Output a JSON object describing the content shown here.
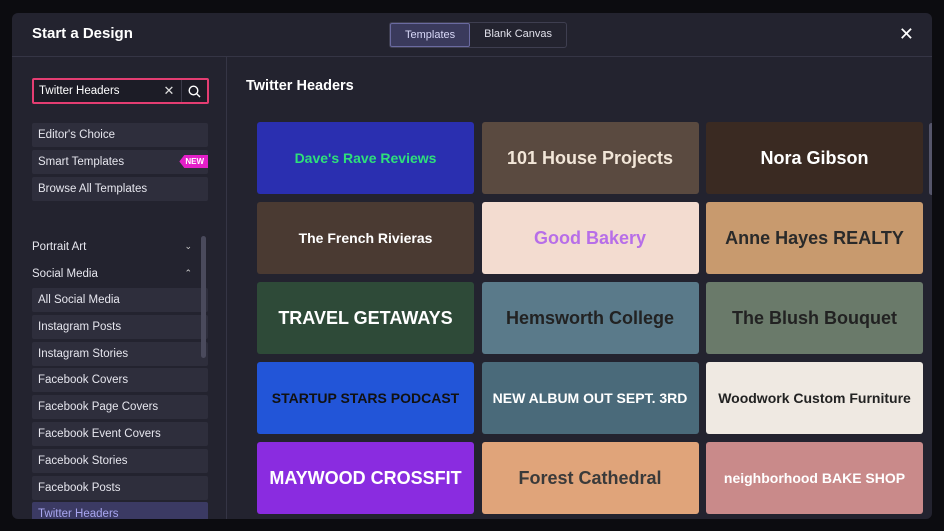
{
  "header": {
    "title": "Start a Design",
    "tabs": [
      "Templates",
      "Blank Canvas"
    ],
    "active_tab": "Templates",
    "close_icon": "close-icon"
  },
  "search": {
    "value": "Twitter Headers"
  },
  "quick": [
    {
      "label": "Editor's Choice"
    },
    {
      "label": "Smart Templates",
      "badge": "NEW"
    },
    {
      "label": "Browse All Templates"
    }
  ],
  "categories": [
    {
      "label": "Portrait Art",
      "expanded": false
    },
    {
      "label": "Social Media",
      "expanded": true
    }
  ],
  "social_items": [
    "All Social Media",
    "Instagram Posts",
    "Instagram Stories",
    "Facebook Covers",
    "Facebook Page Covers",
    "Facebook Event Covers",
    "Facebook Stories",
    "Facebook Posts",
    "Twitter Headers"
  ],
  "selected": "Twitter Headers",
  "main": {
    "title": "Twitter Headers"
  },
  "templates": [
    {
      "text": "Dave's Rave Reviews",
      "bg": "#2a2fb0",
      "fg": "#2ee07a"
    },
    {
      "text": "101 House Projects",
      "bg": "#5a4a40",
      "fg": "#f2e6d8"
    },
    {
      "text": "Nora Gibson",
      "bg": "#3a2a22",
      "fg": "#ffffff"
    },
    {
      "text": "The French Rivieras",
      "bg": "#4a3a32",
      "fg": "#ffffff"
    },
    {
      "text": "Good Bakery",
      "bg": "#f3dcd0",
      "fg": "#b76ee8"
    },
    {
      "text": "Anne Hayes REALTY",
      "bg": "#c89a6e",
      "fg": "#2a2a2a"
    },
    {
      "text": "TRAVEL GETAWAYS",
      "bg": "#2e4a38",
      "fg": "#ffffff"
    },
    {
      "text": "Hemsworth College",
      "bg": "#5a7a8a",
      "fg": "#222222"
    },
    {
      "text": "The Blush Bouquet",
      "bg": "#6a7a6a",
      "fg": "#222222"
    },
    {
      "text": "STARTUP STARS PODCAST",
      "bg": "#2255d8",
      "fg": "#111111"
    },
    {
      "text": "NEW ALBUM OUT SEPT. 3RD",
      "bg": "#4a6a7a",
      "fg": "#ffffff"
    },
    {
      "text": "Woodwork Custom Furniture",
      "bg": "#efe9e2",
      "fg": "#222222"
    },
    {
      "text": "MAYWOOD CROSSFIT",
      "bg": "#8a2ce0",
      "fg": "#ffffff"
    },
    {
      "text": "Forest Cathedral",
      "bg": "#e0a47a",
      "fg": "#3a3a3a"
    },
    {
      "text": "neighborhood BAKE SHOP",
      "bg": "#c98a8a",
      "fg": "#ffffff"
    }
  ]
}
